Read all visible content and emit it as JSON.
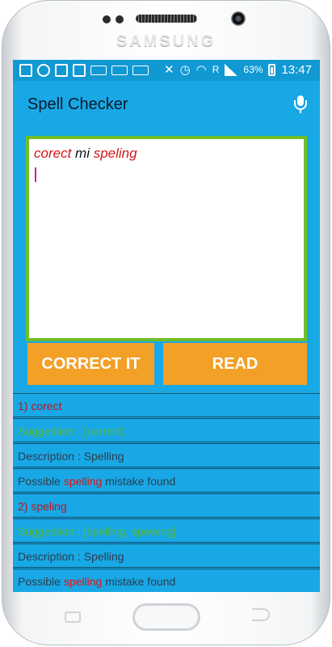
{
  "device": {
    "brand": "SAMSUNG"
  },
  "status_bar": {
    "battery": "63%",
    "time": "13:47",
    "network": "R"
  },
  "app": {
    "title": "Spell Checker"
  },
  "editor": {
    "words": [
      "corect",
      "mi",
      "speling"
    ]
  },
  "buttons": {
    "correct": "CORRECT IT",
    "read": "READ"
  },
  "results": [
    {
      "heading": "1) corect",
      "suggestion": "Suggestion : [correct]",
      "description": "Description : Spelling",
      "note_prefix": "Possible",
      "note_highlight": "spelling",
      "note_suffix": "mistake found"
    },
    {
      "heading": "2) speling",
      "suggestion": "Suggestion : [spelling, spewing]",
      "description": "Description : Spelling",
      "note_prefix": "Possible",
      "note_highlight": "spelling",
      "note_suffix": "mistake found"
    }
  ],
  "colors": {
    "screen": "#18a8e6",
    "status_bar": "#1199d3",
    "button": "#f2a026",
    "editor_border": "#6fbe29",
    "error": "#d01818",
    "suggestion": "#58b832"
  }
}
